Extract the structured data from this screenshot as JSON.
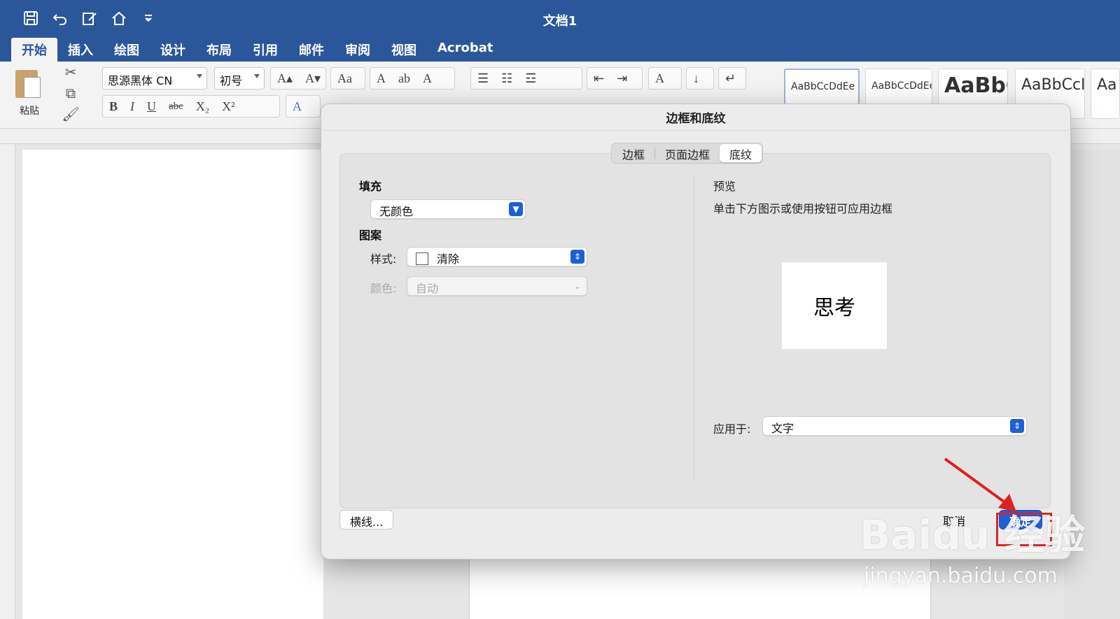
{
  "window": {
    "title": "文档1"
  },
  "ribbon_tabs": [
    "开始",
    "插入",
    "绘图",
    "设计",
    "布局",
    "引用",
    "邮件",
    "审阅",
    "视图",
    "Acrobat"
  ],
  "ribbon": {
    "paste_label": "粘贴",
    "font_name": "思源黑体 CN",
    "font_size": "初号",
    "styles": [
      "AaBbCcDdEe",
      "AaBbCcDdEe",
      "AaBbC",
      "AaBbCcI",
      "Aa"
    ]
  },
  "dialog": {
    "title": "边框和底纹",
    "tabs": [
      "边框",
      "页面边框",
      "底纹"
    ],
    "active_tab": "底纹",
    "fill": {
      "heading": "填充",
      "value": "无颜色"
    },
    "pattern": {
      "heading": "图案",
      "style_label": "样式:",
      "style_value": "清除",
      "color_label": "颜色:",
      "color_value": "自动"
    },
    "preview": {
      "heading": "预览",
      "hint": "单击下方图示或使用按钮可应用边框",
      "sample_text": "思考"
    },
    "apply_to": {
      "label": "应用于:",
      "value": "文字"
    },
    "buttons": {
      "horizontal_line": "横线...",
      "cancel": "取消",
      "ok": "确定"
    }
  },
  "watermark": {
    "brand": "Baidu 经验",
    "url": "jingyan.baidu.com"
  },
  "colors": {
    "ribbon_blue": "#2b579a",
    "accent_blue": "#1e5fd6",
    "highlight_red": "#d62828"
  }
}
